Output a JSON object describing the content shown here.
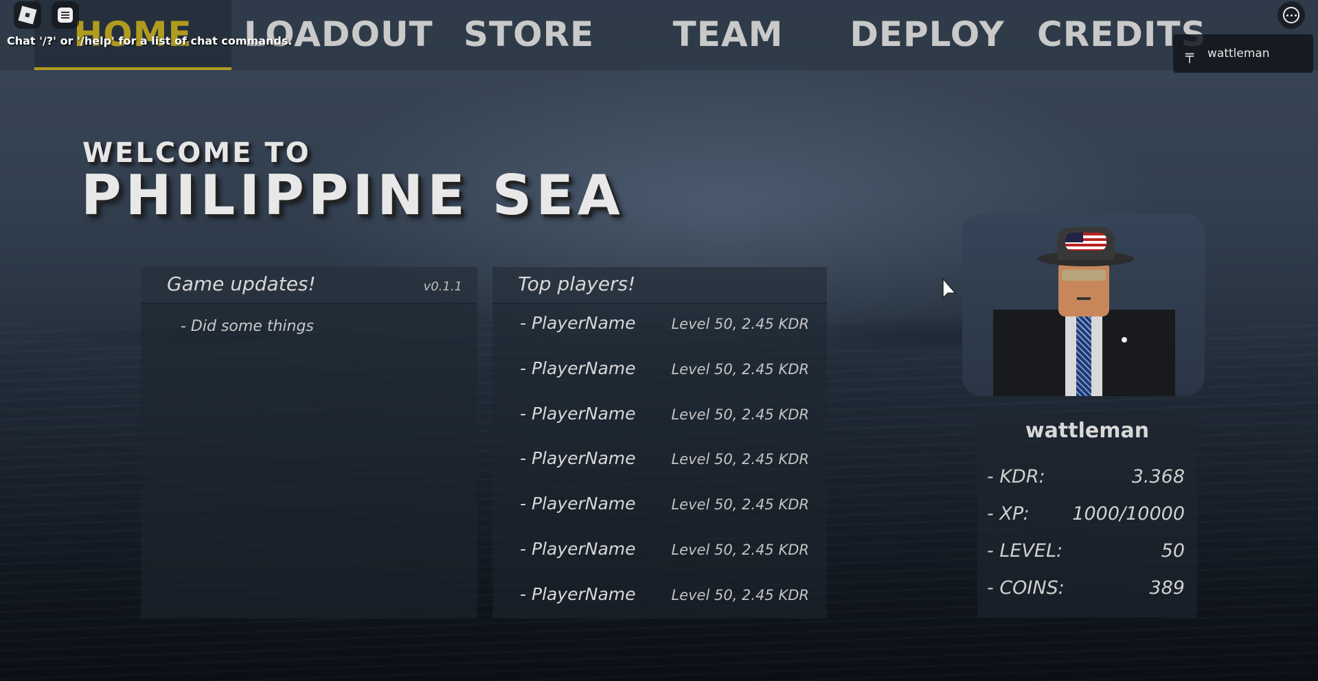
{
  "nav": {
    "tabs": [
      {
        "label": "HOME",
        "active": true
      },
      {
        "label": "LOADOUT",
        "active": false
      },
      {
        "label": "STORE",
        "active": false
      },
      {
        "label": "TEAM",
        "active": false
      },
      {
        "label": "DEPLOY",
        "active": false
      },
      {
        "label": "CREDITS",
        "active": false
      }
    ],
    "active_color": "#b19b1f"
  },
  "chat_hint": "Chat '/?' or '/help' for a list of chat commands.",
  "player_list": {
    "name": "wattleman"
  },
  "hero": {
    "welcome": "WELCOME TO",
    "title": "PHILIPPINE SEA"
  },
  "updates": {
    "title": "Game updates!",
    "version": "v0.1.1",
    "items": [
      "- Did some things"
    ]
  },
  "top_players": {
    "title": "Top players!",
    "rows": [
      {
        "name": "- PlayerName",
        "stat": "Level 50, 2.45 KDR"
      },
      {
        "name": "- PlayerName",
        "stat": "Level 50, 2.45 KDR"
      },
      {
        "name": "- PlayerName",
        "stat": "Level 50, 2.45 KDR"
      },
      {
        "name": "- PlayerName",
        "stat": "Level 50, 2.45 KDR"
      },
      {
        "name": "- PlayerName",
        "stat": "Level 50, 2.45 KDR"
      },
      {
        "name": "- PlayerName",
        "stat": "Level 50, 2.45 KDR"
      },
      {
        "name": "- PlayerName",
        "stat": "Level 50, 2.45 KDR"
      }
    ]
  },
  "profile": {
    "username": "wattleman",
    "stats": [
      {
        "label": "- KDR:",
        "value": "3.368"
      },
      {
        "label": "- XP:",
        "value": "1000/10000"
      },
      {
        "label": "- LEVEL:",
        "value": "50"
      },
      {
        "label": "- COINS:",
        "value": "389"
      }
    ]
  },
  "icons": {
    "roblox": "roblox-logo-icon",
    "chat": "chat-icon",
    "menu": "more-menu-icon",
    "player_list": "player-icon"
  }
}
